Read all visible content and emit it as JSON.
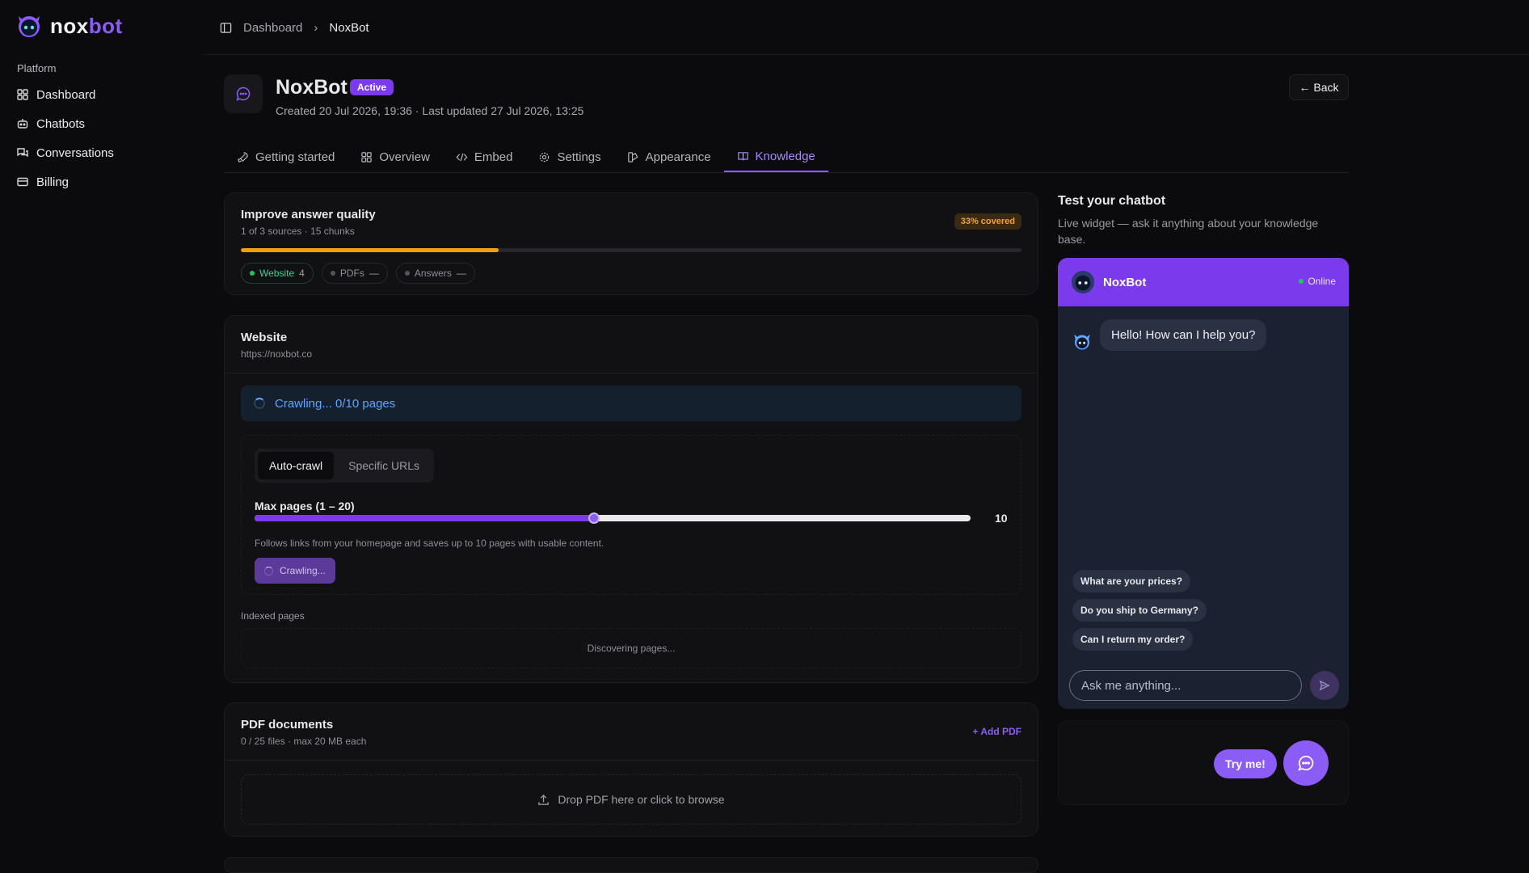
{
  "brand": {
    "word_a": "nox",
    "word_b": "bot"
  },
  "sidebar": {
    "section": "Platform",
    "items": [
      {
        "label": "Dashboard",
        "icon": "grid-icon"
      },
      {
        "label": "Chatbots",
        "icon": "bot-icon"
      },
      {
        "label": "Conversations",
        "icon": "chat-icon"
      },
      {
        "label": "Billing",
        "icon": "card-icon"
      }
    ]
  },
  "breadcrumb": {
    "items": [
      "Dashboard",
      "NoxBot"
    ]
  },
  "bot": {
    "name": "NoxBot",
    "status": "Active",
    "meta": "Created 20 Jul 2026, 19:36 · Last updated 27 Jul 2026, 13:25",
    "back_label": "← Back"
  },
  "tabs": [
    {
      "label": "Getting started",
      "icon": "rocket-icon"
    },
    {
      "label": "Overview",
      "icon": "grid-icon"
    },
    {
      "label": "Embed",
      "icon": "code-icon"
    },
    {
      "label": "Settings",
      "icon": "gear-icon"
    },
    {
      "label": "Appearance",
      "icon": "palette-icon"
    },
    {
      "label": "Knowledge",
      "icon": "book-icon",
      "active": true
    }
  ],
  "quality": {
    "title": "Improve answer quality",
    "subtitle": "1 of 3 sources · 15 chunks",
    "coverage_label": "33% covered",
    "coverage": 0.33,
    "chips": [
      {
        "label": "Website",
        "count": "4"
      },
      {
        "label": "PDFs",
        "count": "—"
      },
      {
        "label": "Answers",
        "count": "—"
      }
    ]
  },
  "website": {
    "title": "Website",
    "url": "https://noxbot.co",
    "crawl_status": "Crawling... 0/10 pages",
    "modes": [
      "Auto-crawl",
      "Specific URLs"
    ],
    "max_pages_label": "Max pages (1 – 20)",
    "max_pages_value": "10",
    "max_pages_min": 1,
    "max_pages_max": 20,
    "help": "Follows links from your homepage and saves up to 10 pages with usable content.",
    "crawl_button": "Crawling...",
    "indexed_label": "Indexed pages",
    "indexed_empty": "Discovering pages..."
  },
  "pdf": {
    "title": "PDF documents",
    "subtitle": "0 / 25 files · max 20 MB each",
    "add_label": "+ Add PDF",
    "drop_label": "Drop PDF here or click to browse"
  },
  "test": {
    "title": "Test your chatbot",
    "subtitle": "Live widget — ask it anything about your knowledge base.",
    "widget_name": "NoxBot",
    "online": "Online",
    "greeting": "Hello! How can I help you?",
    "suggestions": [
      "What are your prices?",
      "Do you ship to Germany?",
      "Can I return my order?"
    ],
    "input_placeholder": "Ask me anything...",
    "try_label": "Try me!"
  },
  "colors": {
    "accent": "#8b5cf6",
    "warning": "#f59e0b",
    "success": "#22c55e",
    "info": "#60a5fa"
  }
}
